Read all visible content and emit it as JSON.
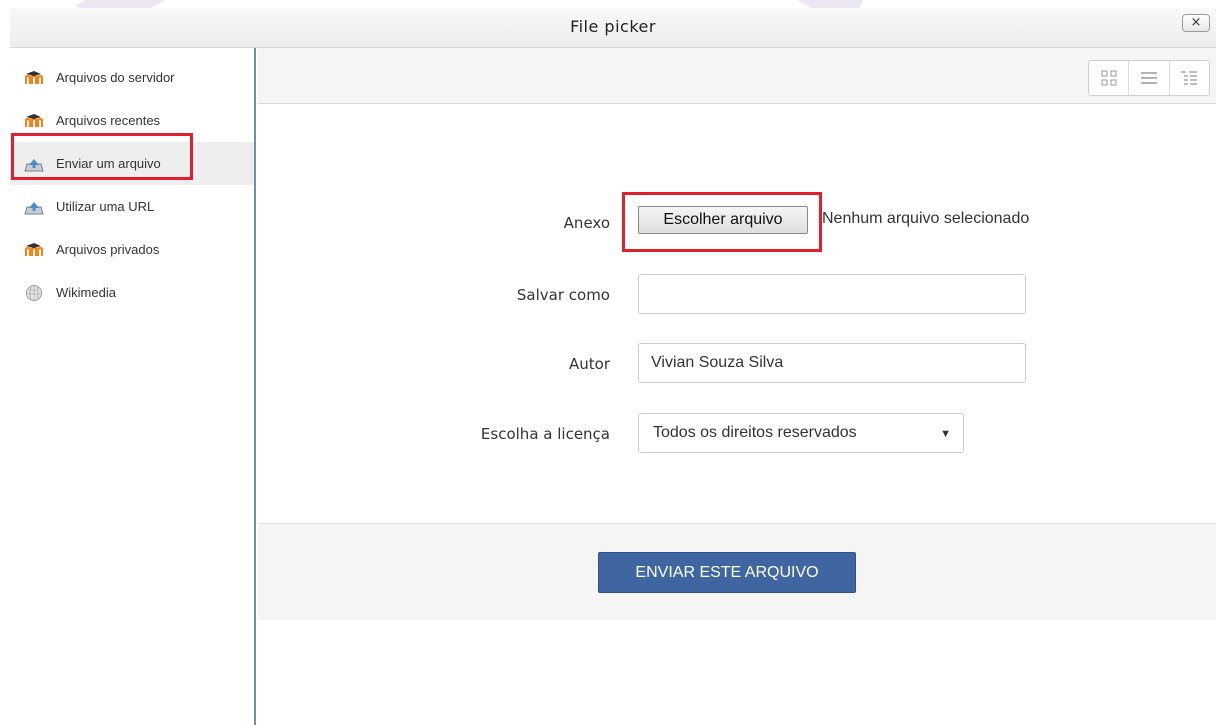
{
  "dialog": {
    "title": "File picker",
    "close_label": "×"
  },
  "sidebar": {
    "items": [
      {
        "label": "Arquivos do servidor",
        "icon": "moodle-icon"
      },
      {
        "label": "Arquivos recentes",
        "icon": "moodle-icon"
      },
      {
        "label": "Enviar um arquivo",
        "icon": "upload-icon",
        "active": true
      },
      {
        "label": "Utilizar uma URL",
        "icon": "upload-icon"
      },
      {
        "label": "Arquivos privados",
        "icon": "moodle-icon"
      },
      {
        "label": "Wikimedia",
        "icon": "wikipedia-globe-icon"
      }
    ]
  },
  "toolbar": {
    "views": [
      "icons-view-icon",
      "list-view-icon",
      "tree-view-icon"
    ]
  },
  "form": {
    "attachment_label": "Anexo",
    "choose_file_label": "Escolher arquivo",
    "no_file_text": "Nenhum arquivo selecionado",
    "save_as_label": "Salvar como",
    "save_as_value": "",
    "author_label": "Autor",
    "author_value": "Vivian Souza Silva",
    "license_label": "Escolha a licença",
    "license_value": "Todos os direitos reservados"
  },
  "footer": {
    "submit_label": "ENVIAR ESTE ARQUIVO"
  },
  "colors": {
    "highlight": "#e0202f",
    "submit": "#3f66a0",
    "moodle_orange": "#f98012"
  }
}
